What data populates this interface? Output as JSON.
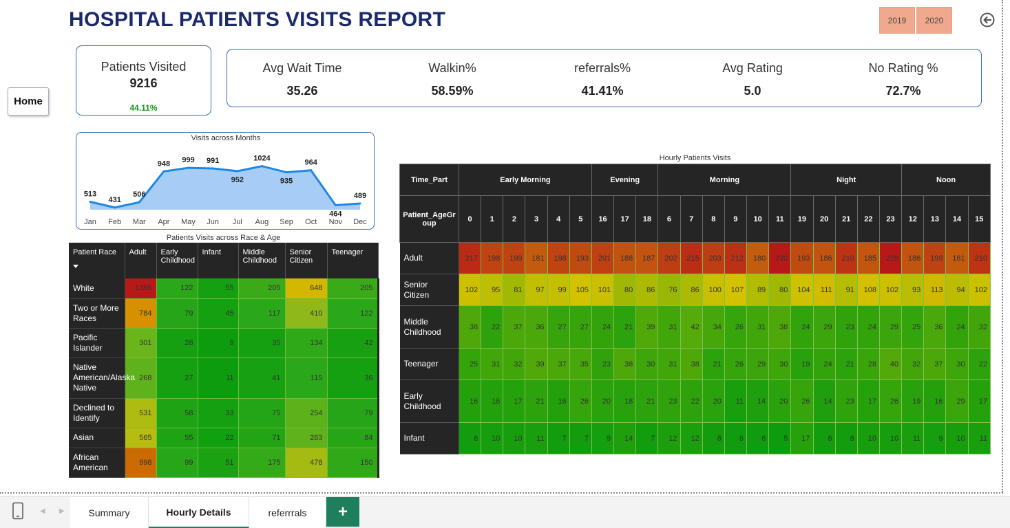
{
  "title": "HOSPITAL PATIENTS VISITS REPORT",
  "years": [
    "2019",
    "2020"
  ],
  "home_label": "Home",
  "patients_card": {
    "label": "Patients Visited",
    "value": "9216",
    "pct": "44.11%"
  },
  "kpis": [
    {
      "label": "Avg Wait Time",
      "value": "35.26"
    },
    {
      "label": "Walkin%",
      "value": "58.59%"
    },
    {
      "label": "referrals%",
      "value": "41.41%"
    },
    {
      "label": "Avg Rating",
      "value": "5.0"
    },
    {
      "label": "No Rating %",
      "value": "72.7%"
    }
  ],
  "chart_data": {
    "type": "area",
    "title": "Visits across Months",
    "categories": [
      "Jan",
      "Feb",
      "Mar",
      "Apr",
      "May",
      "Jun",
      "Jul",
      "Aug",
      "Sep",
      "Oct",
      "Nov",
      "Dec"
    ],
    "values": [
      513,
      431,
      506,
      948,
      999,
      991,
      952,
      1024,
      935,
      964,
      464,
      489
    ],
    "color": "#1e88e5",
    "fill": "#a7cdf7"
  },
  "race_table": {
    "title": "Patients Visits across Race & Age",
    "header": [
      "Patient Race",
      "Adult",
      "Early Childhood",
      "Infant",
      "Middle Childhood",
      "Senior Citizen",
      "Teenager"
    ],
    "rows": [
      {
        "label": "White",
        "values": [
          "1386",
          "122",
          "55",
          "205",
          "648",
          "205"
        ],
        "colors": [
          "#b81818",
          "#2aa81a",
          "#14a011",
          "#3aaa18",
          "#d4b800",
          "#3aaa18"
        ]
      },
      {
        "label": "Two or More Races",
        "values": [
          "784",
          "79",
          "45",
          "117",
          "410",
          "122"
        ],
        "colors": [
          "#d69000",
          "#25a517",
          "#13a011",
          "#2ba81a",
          "#8fb81a",
          "#2aa81a"
        ]
      },
      {
        "label": "Pacific Islander",
        "values": [
          "301",
          "28",
          "9",
          "35",
          "134",
          "42"
        ],
        "colors": [
          "#6ab41c",
          "#14a011",
          "#0d9c0e",
          "#15a011",
          "#30a918",
          "#17a112"
        ]
      },
      {
        "label": "Native American/Alaska Native",
        "values": [
          "268",
          "27",
          "11",
          "41",
          "115",
          "36"
        ],
        "colors": [
          "#60b21c",
          "#14a011",
          "#0d9c0e",
          "#16a012",
          "#2ba81a",
          "#15a011"
        ]
      },
      {
        "label": "Declined to Identify",
        "values": [
          "531",
          "58",
          "33",
          "75",
          "254",
          "79"
        ],
        "colors": [
          "#aebc12",
          "#1ea315",
          "#14a011",
          "#24a516",
          "#5db21c",
          "#25a517"
        ]
      },
      {
        "label": "Asian",
        "values": [
          "565",
          "55",
          "22",
          "71",
          "263",
          "84"
        ],
        "colors": [
          "#b8bc10",
          "#1ea315",
          "#10a010",
          "#22a415",
          "#60b21c",
          "#26a617"
        ]
      },
      {
        "label": "African American",
        "values": [
          "998",
          "99",
          "51",
          "175",
          "478",
          "150"
        ],
        "colors": [
          "#cc6a04",
          "#27a618",
          "#1aa213",
          "#34aa19",
          "#a6ba14",
          "#30a918"
        ]
      }
    ]
  },
  "hourly_table": {
    "title": "Hourly Patients Visits",
    "time_part_label": "Time_Part",
    "age_group_label": "Patient_AgeGroup",
    "groups": [
      {
        "name": "Early Morning",
        "hours": [
          "0",
          "1",
          "2",
          "3",
          "4",
          "5"
        ]
      },
      {
        "name": "Evening",
        "hours": [
          "16",
          "17",
          "18"
        ]
      },
      {
        "name": "Morning",
        "hours": [
          "6",
          "7",
          "8",
          "9",
          "10",
          "11"
        ]
      },
      {
        "name": "Night",
        "hours": [
          "19",
          "20",
          "21",
          "22",
          "23"
        ]
      },
      {
        "name": "Noon",
        "hours": [
          "12",
          "13",
          "14",
          "15"
        ]
      }
    ],
    "rows": [
      {
        "label": "Adult",
        "values": [
          "217",
          "198",
          "199",
          "181",
          "198",
          "193",
          "201",
          "188",
          "187",
          "202",
          "215",
          "203",
          "212",
          "180",
          "230",
          "193",
          "186",
          "210",
          "185",
          "229",
          "186",
          "199",
          "181",
          "210"
        ]
      },
      {
        "label": "Senior Citizen",
        "values": [
          "102",
          "95",
          "81",
          "97",
          "99",
          "105",
          "101",
          "80",
          "86",
          "76",
          "86",
          "100",
          "107",
          "89",
          "80",
          "104",
          "111",
          "91",
          "108",
          "102",
          "93",
          "113",
          "94",
          "102"
        ]
      },
      {
        "label": "Middle Childhood",
        "values": [
          "38",
          "22",
          "37",
          "36",
          "27",
          "27",
          "24",
          "21",
          "39",
          "31",
          "42",
          "34",
          "26",
          "31",
          "38",
          "24",
          "29",
          "23",
          "24",
          "29",
          "25",
          "36",
          "24",
          "32"
        ]
      },
      {
        "label": "Teenager",
        "values": [
          "25",
          "31",
          "32",
          "39",
          "37",
          "35",
          "23",
          "38",
          "30",
          "31",
          "38",
          "21",
          "26",
          "29",
          "30",
          "19",
          "24",
          "21",
          "28",
          "40",
          "32",
          "37",
          "30",
          "22"
        ]
      },
      {
        "label": "Early Childhood",
        "values": [
          "16",
          "16",
          "17",
          "21",
          "16",
          "26",
          "20",
          "18",
          "21",
          "23",
          "22",
          "20",
          "11",
          "14",
          "20",
          "26",
          "14",
          "23",
          "17",
          "26",
          "19",
          "16",
          "29",
          "17"
        ]
      },
      {
        "label": "Infant",
        "values": [
          "8",
          "10",
          "10",
          "11",
          "7",
          "7",
          "9",
          "14",
          "7",
          "12",
          "12",
          "8",
          "6",
          "6",
          "5",
          "17",
          "8",
          "8",
          "10",
          "10",
          "11",
          "9",
          "10",
          "11"
        ]
      }
    ],
    "color_scale": [
      "#0d9c0e",
      "#d4c200",
      "#b81818"
    ]
  },
  "tabs": [
    {
      "label": "Summary",
      "active": false
    },
    {
      "label": "Hourly Details",
      "active": true
    },
    {
      "label": "referrrals",
      "active": false
    }
  ],
  "add_tab_label": "+"
}
